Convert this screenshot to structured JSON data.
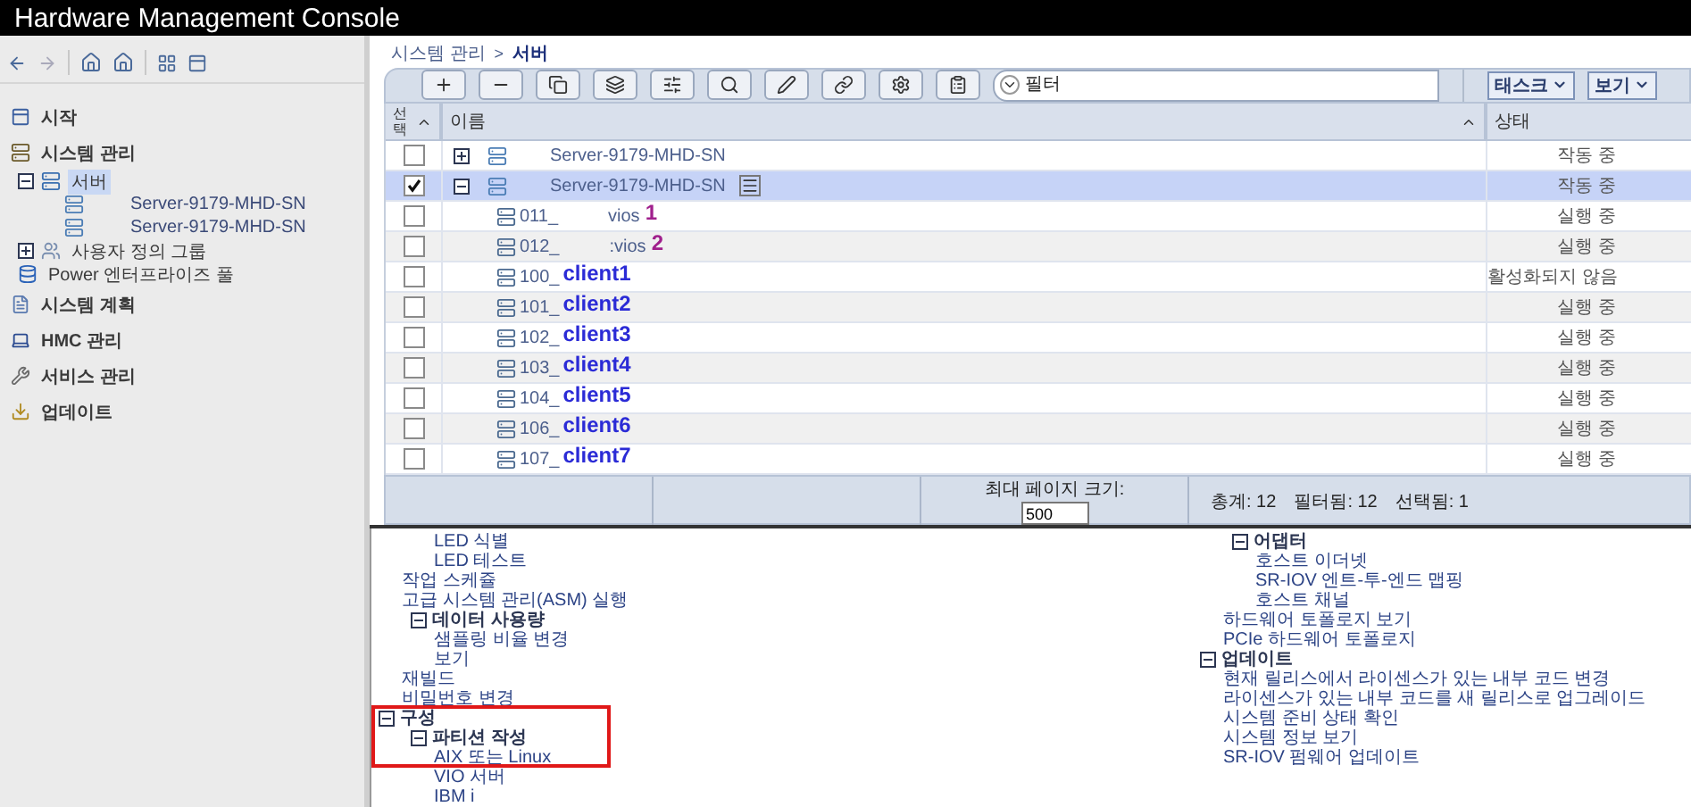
{
  "window": {
    "title": "Hardware Management Console"
  },
  "sidebar": {
    "items": [
      {
        "kind": "start",
        "label": "시작",
        "selected": false
      },
      {
        "kind": "systems",
        "label": "시스템 관리",
        "selected": false,
        "children": [
          {
            "kind": "server",
            "label": "서버",
            "selected": true,
            "expanded": true,
            "children": [
              {
                "kind": "host",
                "label": "Server-9179-MHD-SN",
                "selected": false
              },
              {
                "kind": "host",
                "label": "Server-9179-MHD-SN",
                "selected": false
              }
            ]
          },
          {
            "kind": "group",
            "label": "사용자 정의 그룹",
            "selected": false,
            "expanded": false
          },
          {
            "kind": "pool",
            "label": "Power 엔터프라이즈 풀",
            "selected": false
          }
        ]
      },
      {
        "kind": "plan",
        "label": "시스템 계획",
        "selected": false
      },
      {
        "kind": "hmc",
        "label": "HMC 관리",
        "selected": false
      },
      {
        "kind": "service",
        "label": "서비스 관리",
        "selected": false
      },
      {
        "kind": "update",
        "label": "업데이트",
        "selected": false
      }
    ]
  },
  "breadcrumb": {
    "parent": "시스템 관리",
    "separator": ">",
    "current": "서버"
  },
  "toolbar": {
    "filter": {
      "placeholder": "필터"
    },
    "menus": [
      "태스크",
      "보기"
    ]
  },
  "table": {
    "columns": [
      "선택",
      "이름",
      "상태"
    ],
    "rows": [
      {
        "kind": "server",
        "checked": false,
        "selected": false,
        "expanded": false,
        "name": "Server-9179-MHD-SN",
        "status": "작동 중"
      },
      {
        "kind": "server",
        "checked": true,
        "selected": true,
        "expanded": true,
        "name": "Server-9179-MHD-SN",
        "status": "작동 중"
      },
      {
        "kind": "partition",
        "checked": false,
        "selected": false,
        "prefix": "011_",
        "name": "vios",
        "note": "1",
        "color": "#a01f8c",
        "status": "실행 중"
      },
      {
        "kind": "partition",
        "checked": false,
        "selected": false,
        "prefix": "012_",
        "name": ":vios",
        "note": "2",
        "color": "#a01f8c",
        "status": "실행 중"
      },
      {
        "kind": "partition",
        "checked": false,
        "selected": false,
        "prefix": "100_",
        "note": "client1",
        "color": "#2b2bd6",
        "status": "활성화되지 않음"
      },
      {
        "kind": "partition",
        "checked": false,
        "selected": false,
        "prefix": "101_",
        "note": "client2",
        "color": "#2b2bd6",
        "status": "실행 중"
      },
      {
        "kind": "partition",
        "checked": false,
        "selected": false,
        "prefix": "102_",
        "note": "client3",
        "color": "#2b2bd6",
        "status": "실행 중"
      },
      {
        "kind": "partition",
        "checked": false,
        "selected": false,
        "prefix": "103_",
        "note": "client4",
        "color": "#2b2bd6",
        "status": "실행 중"
      },
      {
        "kind": "partition",
        "checked": false,
        "selected": false,
        "prefix": "104_",
        "note": "client5",
        "color": "#2b2bd6",
        "status": "실행 중"
      },
      {
        "kind": "partition",
        "checked": false,
        "selected": false,
        "prefix": "106_",
        "note": "client6",
        "color": "#2b2bd6",
        "status": "실행 중"
      },
      {
        "kind": "partition",
        "checked": false,
        "selected": false,
        "prefix": "107_",
        "note": "client7",
        "color": "#2b2bd6",
        "status": "실행 중"
      }
    ],
    "footer": {
      "page_size_label": "최대 페이지 크기:",
      "page_size": "500",
      "total": "총계: 12",
      "filtered": "필터됨: 12",
      "selected": "선택됨: 1"
    }
  },
  "tasks": {
    "highlight_frame": true,
    "left_column": [
      {
        "children": [
          {
            "children": [
              {
                "label": "LED 식별"
              },
              {
                "label": "LED 테스트"
              }
            ]
          },
          {
            "label": "작업 스케쥴"
          },
          {
            "label": "고급 시스템 관리(ASM) 실행"
          },
          {
            "label": "데이터 사용량",
            "expanded": true,
            "children": [
              {
                "label": "샘플링 비율 변경"
              },
              {
                "label": "보기"
              }
            ]
          },
          {
            "label": "재빌드"
          },
          {
            "label": "비밀번호 변경"
          }
        ]
      },
      {
        "label": "구성",
        "expanded": true,
        "children": [
          {
            "label": "파티션 작성",
            "expanded": true,
            "children": [
              {
                "label": "AIX 또는 Linux"
              },
              {
                "label": "VIO 서버"
              },
              {
                "label": "IBM i"
              }
            ]
          }
        ]
      }
    ],
    "right_column": [
      {
        "children": [
          {
            "label": "어댑터",
            "expanded": true,
            "children": [
              {
                "label": "호스트 이더넷"
              },
              {
                "label": "SR-IOV 엔트-투-엔드 맵핑"
              },
              {
                "label": "호스트 채널"
              }
            ]
          },
          {
            "label": "하드웨어 토폴로지 보기"
          },
          {
            "label": "PCIe 하드웨어 토폴로지"
          }
        ]
      },
      {
        "label": "업데이트",
        "expanded": true,
        "children": [
          {
            "label": "현재 릴리스에서 라이센스가 있는 내부 코드 변경"
          },
          {
            "label": "라이센스가 있는 내부 코드를 새 릴리스로 업그레이드"
          },
          {
            "label": "시스템 준비 상태 확인"
          },
          {
            "label": "시스템 정보 보기"
          },
          {
            "label": "SR-IOV 펌웨어 업데이트"
          }
        ]
      }
    ]
  }
}
